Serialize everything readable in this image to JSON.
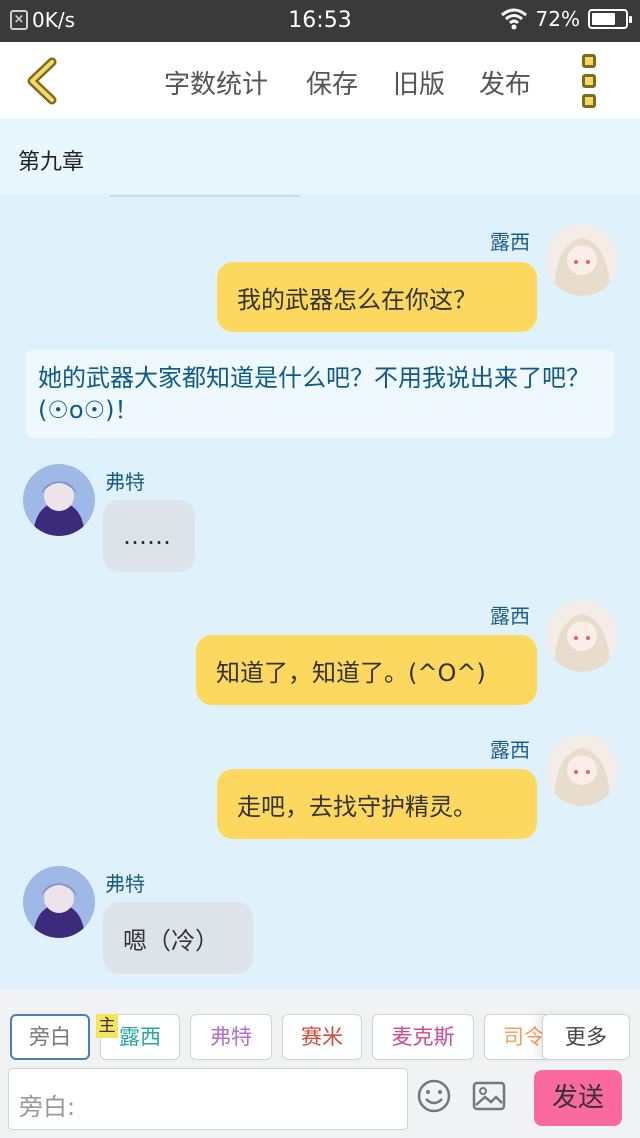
{
  "status_bar": {
    "net_speed": "0K/s",
    "time": "16:53",
    "battery_text": "72%",
    "battery_level": 0.72
  },
  "top_nav": {
    "word_count": "字数统计",
    "save": "保存",
    "old_version": "旧版",
    "publish": "发布"
  },
  "chapter": {
    "title": "第九章"
  },
  "messages": [
    {
      "speaker": "露西",
      "text": "我的武器怎么在你这？"
    },
    {
      "text": "她的武器大家都知道是什么吧？不用我说出来了吧？(☉o☉)！"
    },
    {
      "speaker": "弗特",
      "text": "……"
    },
    {
      "speaker": "露西",
      "text": "知道了，知道了。(^O^)"
    },
    {
      "speaker": "露西",
      "text": "走吧，去找守护精灵。"
    },
    {
      "speaker": "弗特",
      "text": "嗯（冷）"
    }
  ],
  "character_bar": {
    "main_badge": "主",
    "chips": [
      "旁白",
      "露西",
      "弗特",
      "赛米",
      "麦克斯",
      "司令"
    ],
    "chip_colors": [
      "#777777",
      "#23a8a0",
      "#b36fd1",
      "#d14b3c",
      "#d04a93",
      "#f0a060"
    ],
    "more": "更多"
  },
  "input_bar": {
    "placeholder": "旁白:",
    "send": "发送"
  }
}
